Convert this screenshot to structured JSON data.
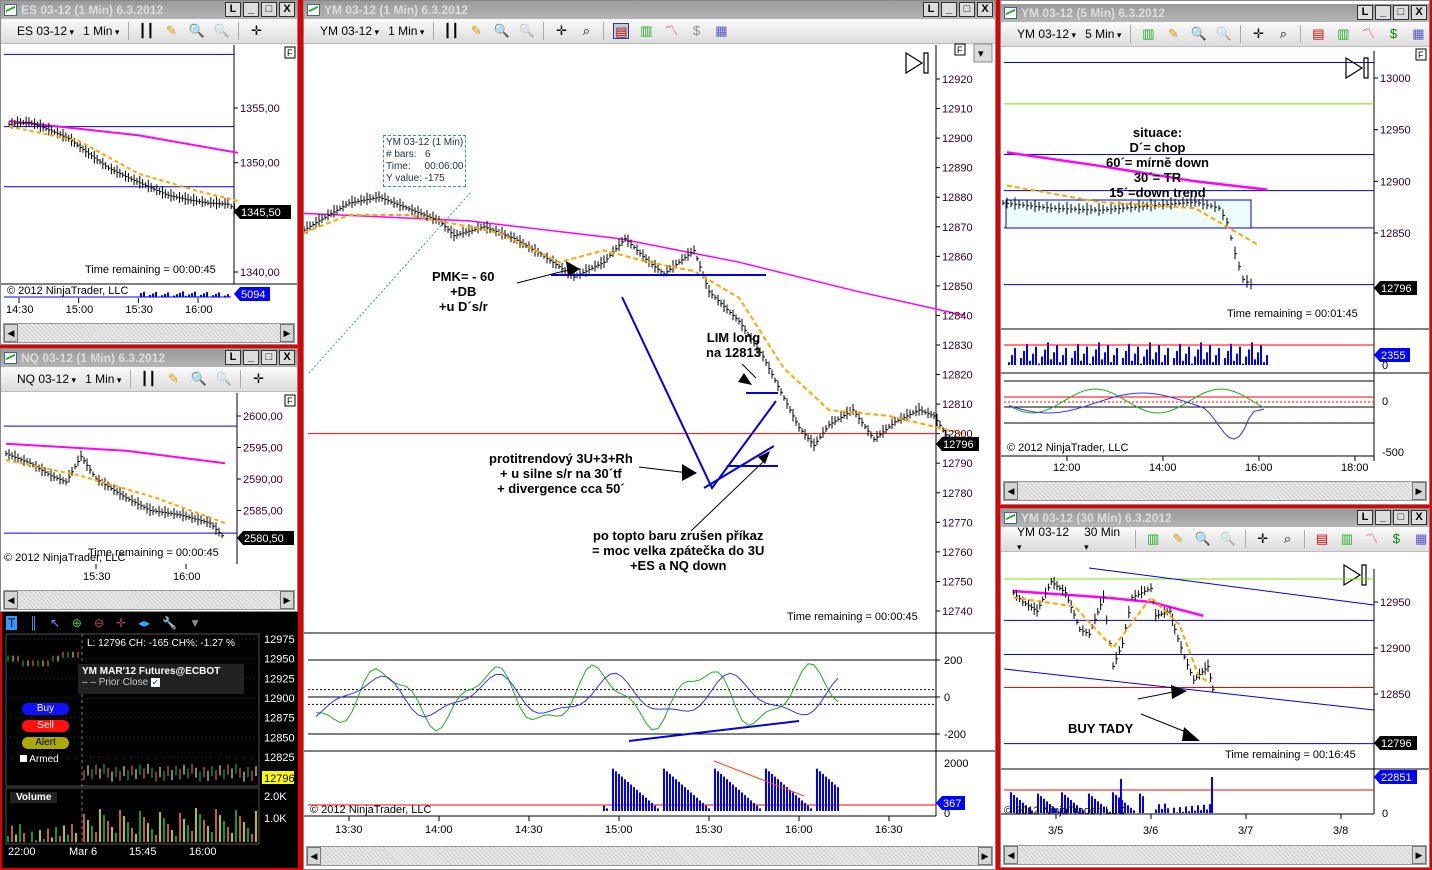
{
  "colors": {
    "accent_red": "#e00000",
    "ma_fast": "#ffa500",
    "ma_slow": "#ff00ff",
    "level_blue": "#0000e0",
    "level_green": "#7fe000",
    "volume": "#0000ff"
  },
  "common": {
    "copyright": "© 2012 NinjaTrader, LLC",
    "win_buttons": [
      "L",
      "_",
      "□",
      "X"
    ],
    "overflow_flag": "F"
  },
  "es": {
    "title": "ES 03-12 (1 Min)  6.3.2012",
    "instrument": "ES 03-12",
    "interval": "1 Min",
    "price_ticks": [
      "1355,00",
      "1350,00",
      "1340,00"
    ],
    "last_price": "1345,50",
    "volume_last": "5094",
    "time_remaining": "Time remaining = 00:00:45",
    "time_ticks": [
      "14:30",
      "15:00",
      "15:30",
      "16:00"
    ],
    "series": [
      [
        -5,
        1353.5
      ],
      [
        5,
        1353.7
      ],
      [
        15,
        1353.0
      ],
      [
        25,
        1352.2
      ],
      [
        35,
        1350.8
      ],
      [
        45,
        1349.5
      ],
      [
        55,
        1348.6
      ],
      [
        65,
        1347.8
      ],
      [
        75,
        1347.0
      ],
      [
        85,
        1346.6
      ],
      [
        95,
        1346.3
      ],
      [
        105,
        1346.2
      ],
      [
        110,
        1345.5
      ]
    ],
    "ma": [
      [
        -5,
        1353.8
      ],
      [
        60,
        1352.5
      ],
      [
        110,
        1350.9
      ]
    ],
    "ema": [
      [
        -5,
        1353.3
      ],
      [
        30,
        1352
      ],
      [
        60,
        1349
      ],
      [
        90,
        1347.4
      ],
      [
        110,
        1346.5
      ]
    ],
    "hlines": [
      1359.9,
      1353.3,
      1347.8
    ]
  },
  "nq": {
    "title": "NQ 03-12 (1 Min)  6.3.2012",
    "instrument": "NQ 03-12",
    "interval": "1 Min",
    "price_ticks": [
      "2600,00",
      "2595,00",
      "2590,00",
      "2585,00"
    ],
    "last_price": "2580,50",
    "time_remaining": "Time remaining = 00:00:45",
    "time_ticks": [
      "15:30",
      "16:00"
    ],
    "series": [
      [
        0,
        2594
      ],
      [
        8,
        2592.5
      ],
      [
        15,
        2590.5
      ],
      [
        20,
        2589.5
      ],
      [
        25,
        2593.6
      ],
      [
        30,
        2590
      ],
      [
        40,
        2587
      ],
      [
        48,
        2585
      ],
      [
        58,
        2584.3
      ],
      [
        68,
        2583
      ],
      [
        73,
        2580.5
      ]
    ],
    "ma": [
      [
        0,
        2595.6
      ],
      [
        40,
        2594.5
      ],
      [
        73,
        2592.5
      ]
    ],
    "ema": [
      [
        0,
        2593
      ],
      [
        25,
        2590.5
      ],
      [
        50,
        2587
      ],
      [
        73,
        2583
      ]
    ],
    "hlines": [
      2598.4,
      2581.4
    ]
  },
  "main": {
    "title": "YM 03-12 (1 Min)  6.3.2012",
    "instrument": "YM 03-12",
    "interval": "1 Min",
    "price_ticks": [
      "12920",
      "12910",
      "12900",
      "12890",
      "12880",
      "12870",
      "12860",
      "12850",
      "12840",
      "12830",
      "12820",
      "12810",
      "12800",
      "12790",
      "12780",
      "12770",
      "12760",
      "12750",
      "12740"
    ],
    "last_price": "12796",
    "osc_ticks": [
      "200",
      "0",
      "-200"
    ],
    "vol_ticks": [
      "2000",
      "0"
    ],
    "volume_last": "367",
    "time_ticks": [
      "13:30",
      "14:00",
      "14:30",
      "15:00",
      "15:30",
      "16:00",
      "16:30"
    ],
    "time_remaining": "Time remaining = 00:00:45",
    "series": [
      [
        5,
        12861
      ],
      [
        12,
        12867
      ],
      [
        20,
        12872
      ],
      [
        30,
        12878
      ],
      [
        40,
        12880
      ],
      [
        50,
        12876
      ],
      [
        60,
        12872
      ],
      [
        65,
        12867
      ],
      [
        75,
        12870
      ],
      [
        85,
        12866
      ],
      [
        95,
        12860
      ],
      [
        105,
        12853
      ],
      [
        115,
        12858
      ],
      [
        122,
        12866
      ],
      [
        130,
        12858
      ],
      [
        135,
        12854
      ],
      [
        145,
        12862
      ],
      [
        150,
        12848
      ],
      [
        160,
        12838
      ],
      [
        168,
        12826
      ],
      [
        175,
        12812
      ],
      [
        180,
        12802
      ],
      [
        185,
        12796
      ],
      [
        190,
        12803
      ],
      [
        198,
        12808
      ],
      [
        205,
        12798
      ],
      [
        212,
        12804
      ],
      [
        220,
        12808
      ],
      [
        225,
        12806
      ],
      [
        230,
        12798
      ],
      [
        235,
        12796
      ]
    ],
    "ema": [
      [
        5,
        12864
      ],
      [
        30,
        12874
      ],
      [
        50,
        12874
      ],
      [
        80,
        12868
      ],
      [
        100,
        12858
      ],
      [
        115,
        12862
      ],
      [
        130,
        12858
      ],
      [
        145,
        12855
      ],
      [
        160,
        12846
      ],
      [
        175,
        12822
      ],
      [
        190,
        12808
      ],
      [
        210,
        12806
      ],
      [
        235,
        12800
      ]
    ],
    "ma": [
      [
        5,
        12875
      ],
      [
        70,
        12872
      ],
      [
        120,
        12866
      ],
      [
        160,
        12858
      ],
      [
        200,
        12848
      ],
      [
        235,
        12840
      ]
    ],
    "hline_red": 12800,
    "tooltip": {
      "line1": "YM 03-12 (1 Min)",
      "line2_label": "# bars:",
      "line2_value": "6",
      "line3_label": "Time:",
      "line3_value": "00:06:00",
      "line4": "Y value: -175"
    },
    "annotations": {
      "pmk": [
        "PMK= - 60",
        "+DB",
        "+u D´s/r"
      ],
      "lim": [
        "LIM long",
        "na 12813"
      ],
      "protitrend": [
        "protitrendový 3U+3+Rh",
        "+ u silne s/r na 30´tf",
        "+ divergence cca 50´"
      ],
      "topto": [
        "po topto baru zrušen příkaz",
        "= moc velka zpátečka do 3U",
        "+ES a NQ down"
      ]
    }
  },
  "ym5": {
    "title": "YM 03-12 (5 Min)  6.3.2012",
    "instrument": "YM 03-12",
    "interval": "5 Min",
    "price_ticks": [
      "13000",
      "12950",
      "12900",
      "12850"
    ],
    "last_price": "12796",
    "volume_last": "2355",
    "osc_ticks": [
      "0",
      "-500"
    ],
    "time_ticks": [
      "12:00",
      "14:00",
      "16:00",
      "18:00"
    ],
    "time_remaining": "Time remaining = 00:01:45",
    "situation": [
      "situace:",
      "D´= chop",
      "60´= mírně down",
      "30´= TR",
      "15´=down trend"
    ],
    "series": [
      [
        640,
        12879
      ],
      [
        700,
        12874
      ],
      [
        760,
        12872
      ],
      [
        820,
        12876
      ],
      [
        880,
        12880
      ],
      [
        910,
        12874
      ],
      [
        920,
        12860
      ],
      [
        930,
        12830
      ],
      [
        940,
        12805
      ],
      [
        950,
        12800
      ],
      [
        955,
        12796
      ]
    ],
    "ma": [
      [
        645,
        12928
      ],
      [
        760,
        12915
      ],
      [
        880,
        12900
      ],
      [
        970,
        12892
      ]
    ],
    "ema": [
      [
        645,
        12896
      ],
      [
        760,
        12880
      ],
      [
        880,
        12874
      ],
      [
        960,
        12838
      ]
    ],
    "hlines": [
      13015,
      12926,
      12891,
      12855,
      12800
    ],
    "hline_green": 12975
  },
  "ym30": {
    "title": "YM 03-12 (30 Min)  6.3.2012",
    "instrument": "YM 03-12",
    "interval": "30 Min",
    "price_ticks": [
      "12950",
      "12900",
      "12850"
    ],
    "last_price": "12796",
    "volume_last": "22851",
    "vol_ticks": [
      "0"
    ],
    "date_ticks": [
      "3/5",
      "3/6",
      "3/7",
      "3/8"
    ],
    "time_remaining": "Time remaining = 00:16:45",
    "buy_label": "BUY TADY",
    "series": [
      [
        -0.45,
        12960
      ],
      [
        -0.35,
        12950
      ],
      [
        -0.2,
        12940
      ],
      [
        -0.05,
        12972
      ],
      [
        0.1,
        12960
      ],
      [
        0.25,
        12920
      ],
      [
        0.35,
        12915
      ],
      [
        0.5,
        12955
      ],
      [
        0.6,
        12880
      ],
      [
        0.7,
        12905
      ],
      [
        0.8,
        12955
      ],
      [
        1.0,
        12965
      ],
      [
        1.05,
        12935
      ],
      [
        1.2,
        12940
      ],
      [
        1.25,
        12920
      ],
      [
        1.35,
        12890
      ],
      [
        1.45,
        12865
      ],
      [
        1.6,
        12880
      ],
      [
        1.65,
        12855
      ],
      [
        1.68,
        12796
      ]
    ],
    "ma": [
      [
        -0.45,
        12962
      ],
      [
        0.5,
        12955
      ],
      [
        1.0,
        12950
      ],
      [
        1.55,
        12935
      ]
    ],
    "ema": [
      [
        -0.45,
        12955
      ],
      [
        0.2,
        12945
      ],
      [
        0.6,
        12900
      ],
      [
        1.0,
        12955
      ],
      [
        1.3,
        12925
      ],
      [
        1.5,
        12870
      ],
      [
        1.62,
        12862
      ]
    ],
    "hlines": [
      12930,
      12893,
      12796
    ],
    "hline_green": 12975,
    "hline_red": 12857
  },
  "ib": {
    "last_line": "L: 12796 CH: -165 CH%: -1.27 %",
    "contract": "YM MAR'12 Futures@ECBOT",
    "prior_close": "Prior Close",
    "buy": "Buy",
    "sell": "Sell",
    "alert": "Alert",
    "armed": "Armed",
    "volume_label": "Volume",
    "price_ticks": [
      "12975",
      "12950",
      "12925",
      "12900",
      "12875",
      "12850",
      "12825"
    ],
    "last_price": "12796",
    "vol_ticks": [
      "2.0K",
      "1.0K"
    ],
    "time_ticks": [
      "22:00",
      "Mar 6",
      "15:45",
      "16:00"
    ]
  }
}
